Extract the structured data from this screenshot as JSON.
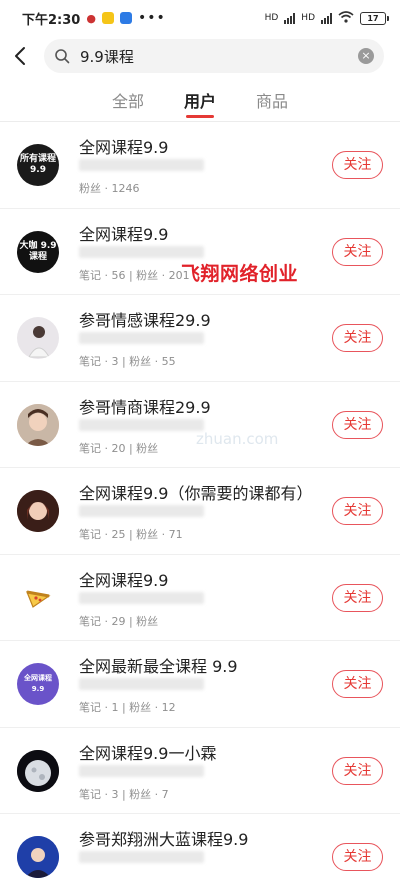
{
  "status_bar": {
    "time": "下午2:30",
    "signal1_label": "HD",
    "signal2_label": "HD",
    "battery": "17"
  },
  "search": {
    "query": "9.9课程"
  },
  "tabs": [
    {
      "label": "全部",
      "active": false
    },
    {
      "label": "用户",
      "active": true
    },
    {
      "label": "商品",
      "active": false
    }
  ],
  "results": [
    {
      "name": "全网课程9.9",
      "stats": "粉丝 · 1246",
      "avatar_text": "所有课程 9.9",
      "avatar_color": "#1a1a1a",
      "follow_label": "关注"
    },
    {
      "name": "全网课程9.9",
      "stats": "笔记 · 56 | 粉丝 · 201",
      "avatar_text": "大咖 9.9课程",
      "avatar_color": "#111111",
      "follow_label": "关注"
    },
    {
      "name": "参哥情感课程29.9",
      "stats": "笔记 · 3 | 粉丝 · 55",
      "avatar_text": "",
      "avatar_color": "#e9e6ea",
      "follow_label": "关注"
    },
    {
      "name": "参哥情商课程29.9",
      "stats": "笔记 · 20 | 粉丝",
      "avatar_text": "",
      "avatar_color": "#d7b39a",
      "follow_label": "关注"
    },
    {
      "name": "全网课程9.9（你需要的课都有）",
      "stats": "笔记 · 25 | 粉丝 · 71",
      "avatar_text": "",
      "avatar_color": "#5a2e22",
      "follow_label": "关注"
    },
    {
      "name": "全网课程9.9",
      "stats": "笔记 · 29 | 粉丝",
      "avatar_text": "",
      "avatar_color": "#ffffff",
      "follow_label": "关注"
    },
    {
      "name": "全网最新最全课程 9.9",
      "stats": "笔记 · 1 | 粉丝 · 12",
      "avatar_text": "全网课程 9.9",
      "avatar_color": "#6a53c9",
      "follow_label": "关注"
    },
    {
      "name": "全网课程9.9一小霖",
      "stats": "笔记 · 3 | 粉丝 · 7",
      "avatar_text": "",
      "avatar_color": "#0c0c12",
      "follow_label": "关注"
    },
    {
      "name": "参哥郑翔洲大蓝课程9.9",
      "stats": "",
      "avatar_text": "",
      "avatar_color": "#1f3fa8",
      "follow_label": "关注"
    }
  ],
  "watermark": "飞翔网络创业",
  "faint_watermark": "zhuan.com",
  "colors": {
    "accent": "#e53935",
    "muted": "#8f8f8f"
  }
}
